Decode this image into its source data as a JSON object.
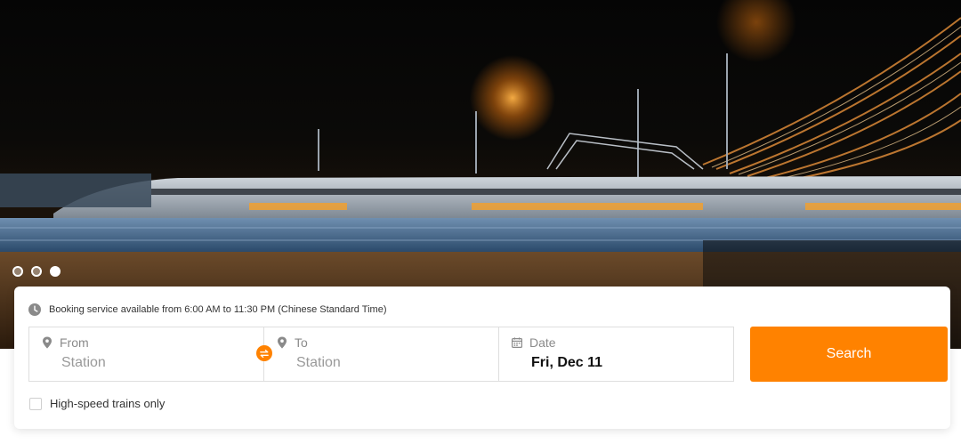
{
  "carousel": {
    "slide_count": 3,
    "active_index": 2
  },
  "booking": {
    "notice": "Booking service available from 6:00 AM to 11:30 PM (Chinese Standard Time)",
    "from": {
      "label": "From",
      "placeholder": "Station"
    },
    "to": {
      "label": "To",
      "placeholder": "Station"
    },
    "date": {
      "label": "Date",
      "value": "Fri, Dec 11"
    },
    "search_label": "Search",
    "high_speed_label": "High-speed trains only",
    "high_speed_checked": false
  },
  "icons": {
    "clock": "clock-icon",
    "from": "location-pin-icon",
    "to": "location-pin-icon",
    "date": "calendar-icon",
    "swap": "swap-arrows-icon"
  },
  "colors": {
    "accent": "#ff8200",
    "border": "#dedede",
    "placeholder": "#9a9a9a",
    "text": "#333333"
  }
}
